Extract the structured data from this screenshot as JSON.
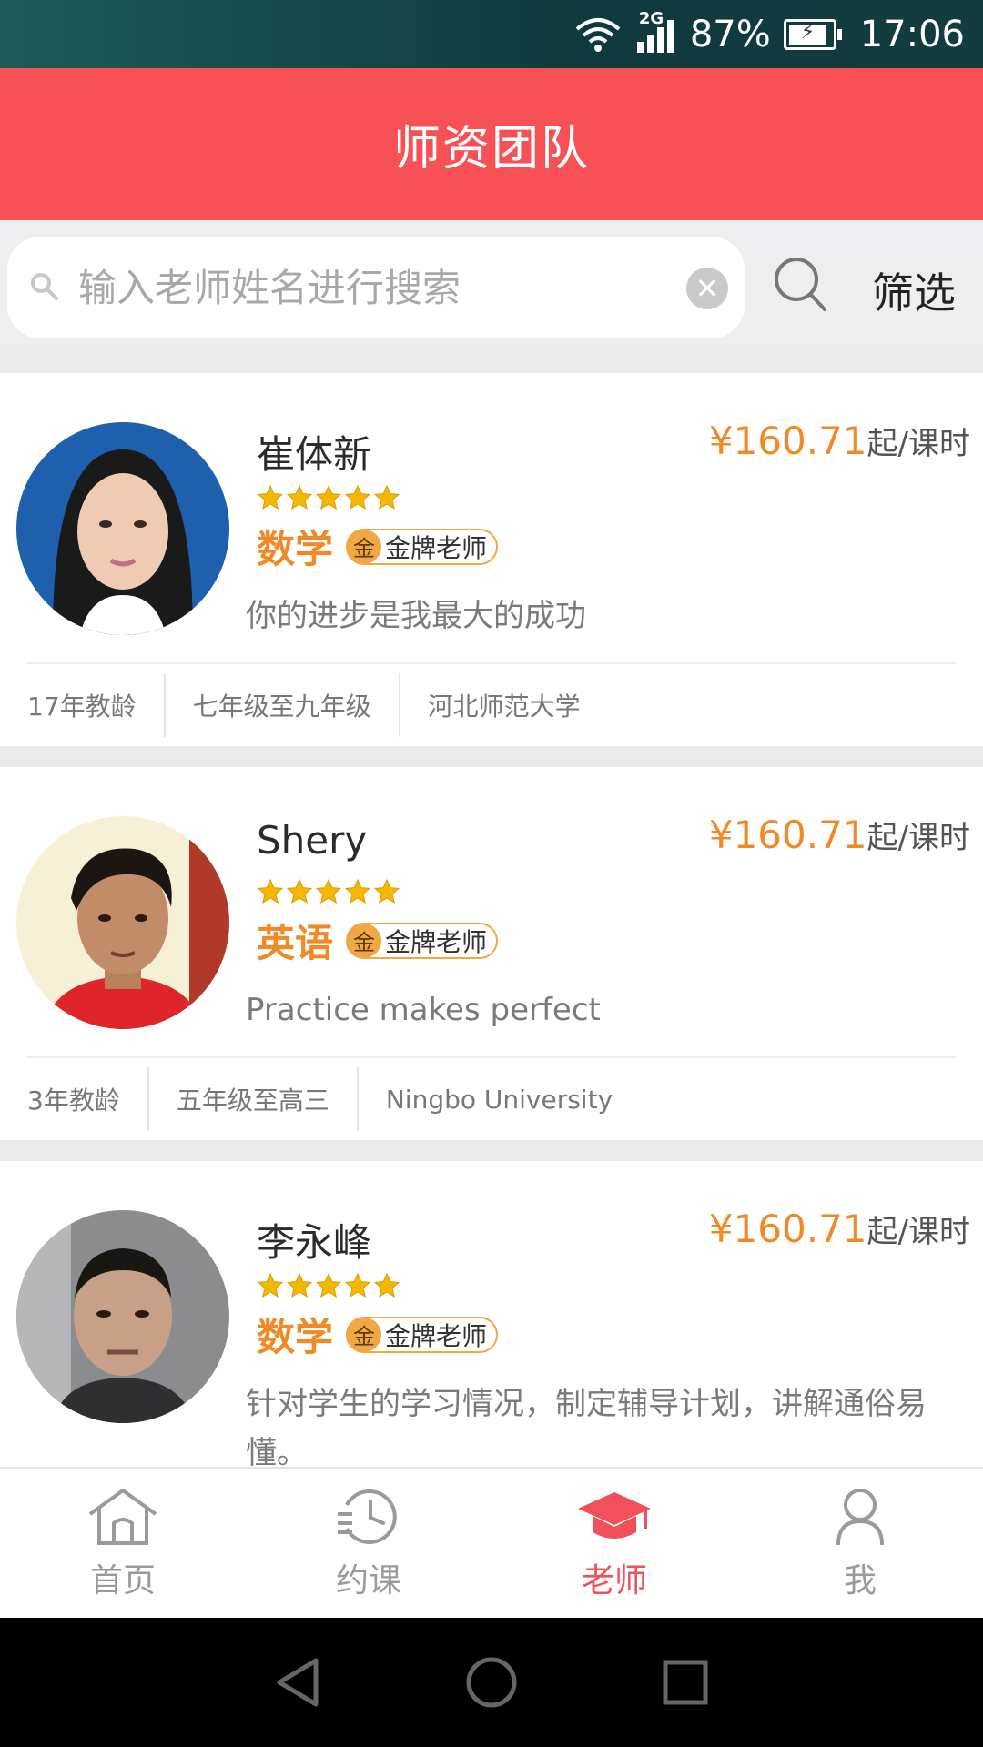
{
  "status_bar": {
    "network": "2G",
    "battery": "87%",
    "time": "17:06"
  },
  "header": {
    "title": "师资团队"
  },
  "search": {
    "placeholder": "输入老师姓名进行搜索",
    "value": "",
    "filter_label": "筛选"
  },
  "teachers": [
    {
      "name": "崔体新",
      "price": "¥160.71",
      "price_unit": "起/课时",
      "rating": 5,
      "subject": "数学",
      "badge": "金牌老师",
      "badge_medal": "金",
      "motto": "你的进步是我最大的成功",
      "experience": "17年教龄",
      "grades": "七年级至九年级",
      "school": "河北师范大学"
    },
    {
      "name": "Shery",
      "price": "¥160.71",
      "price_unit": "起/课时",
      "rating": 5,
      "subject": "英语",
      "badge": "金牌老师",
      "badge_medal": "金",
      "motto": "Practice makes perfect",
      "experience": "3年教龄",
      "grades": "五年级至高三",
      "school": "Ningbo University"
    },
    {
      "name": "李永峰",
      "price": "¥160.71",
      "price_unit": "起/课时",
      "rating": 5,
      "subject": "数学",
      "badge": "金牌老师",
      "badge_medal": "金",
      "motto": "针对学生的学习情况，制定辅导计划，讲解通俗易懂。"
    }
  ],
  "bottom_nav": {
    "items": [
      {
        "label": "首页",
        "icon": "home-icon"
      },
      {
        "label": "约课",
        "icon": "history-clock-icon"
      },
      {
        "label": "老师",
        "icon": "graduation-cap-icon"
      },
      {
        "label": "我",
        "icon": "person-icon"
      }
    ],
    "active_index": 2
  },
  "colors": {
    "brand_red": "#f75055",
    "price_orange": "#f08a26",
    "active_nav": "#f0505a"
  }
}
